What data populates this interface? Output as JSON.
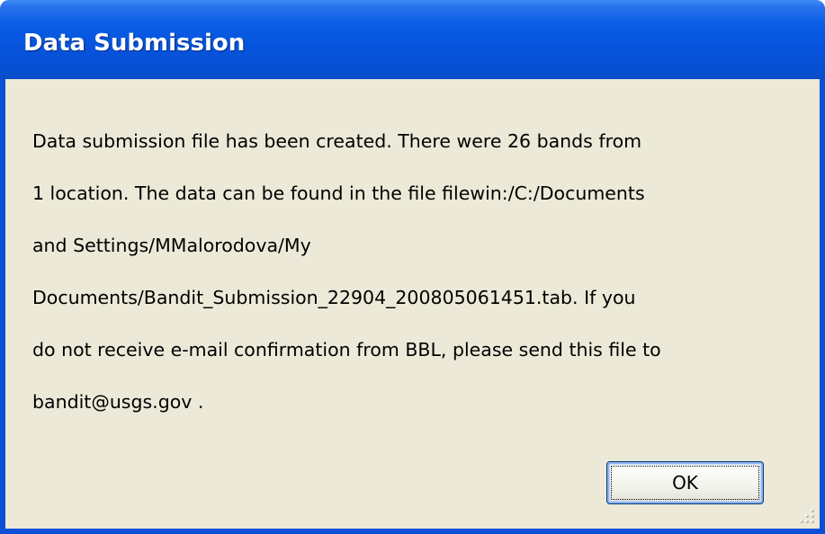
{
  "window": {
    "title": "Data Submission"
  },
  "message": {
    "lines": [
      "Data submission file has been created. There were 26 bands from",
      "1 location. The data can be found in the file filewin:/C:/Documents",
      "and Settings/MMalorodova/My",
      "Documents/Bandit_Submission_22904_200805061451.tab. If you",
      "do not receive e-mail confirmation from BBL, please send this file to",
      "bandit@usgs.gov ."
    ]
  },
  "buttons": {
    "ok_label": "OK"
  },
  "icons": {
    "resize_grip": "resize-grip-icon"
  },
  "colors": {
    "titlebar": "#0a5ee6",
    "client_background": "#ece9d8",
    "frame": "#0a4fd6"
  }
}
